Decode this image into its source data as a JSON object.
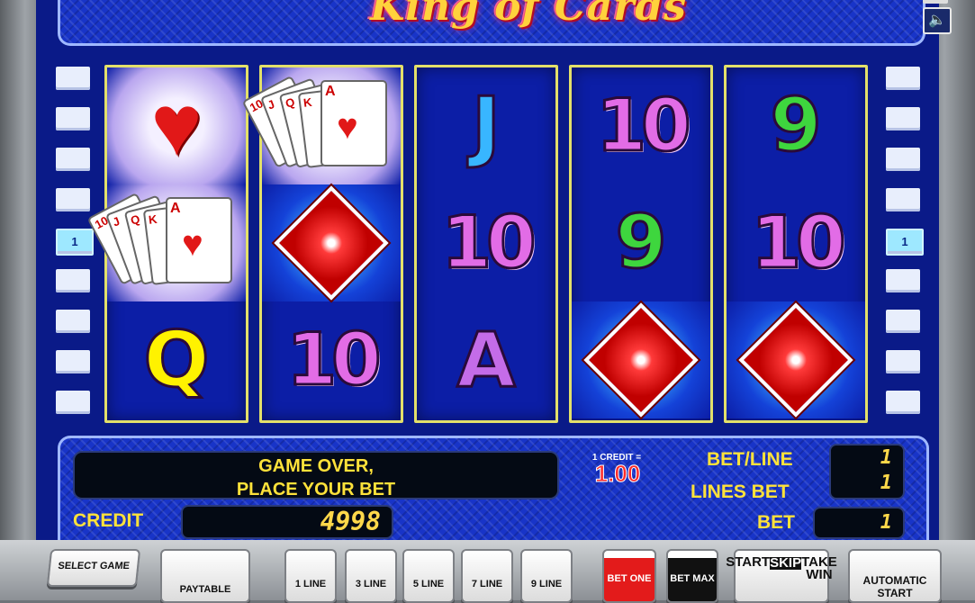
{
  "game": {
    "title": "King of Cards",
    "sound_icon": "speaker-icon"
  },
  "paylines": {
    "left_marker": "1",
    "right_marker": "1"
  },
  "reels": [
    [
      "heart",
      "cards",
      "Q"
    ],
    [
      "cards",
      "diamond",
      "10"
    ],
    [
      "J",
      "10",
      "A"
    ],
    [
      "10",
      "9",
      "diamond"
    ],
    [
      "9",
      "10",
      "diamond"
    ]
  ],
  "status": {
    "message_line1": "GAME OVER,",
    "message_line2": "PLACE YOUR BET",
    "credit_value_label": "1 CREDIT =",
    "credit_value": "1.00"
  },
  "meters": {
    "credit_label": "CREDIT",
    "credit": "4998",
    "bet_line_label": "BET/LINE",
    "bet_line": "1",
    "lines_bet_label": "LINES BET",
    "lines_bet": "1",
    "bet_label": "BET",
    "bet": "1"
  },
  "buttons": {
    "select_game": "SELECT GAME",
    "paytable": "PAYTABLE",
    "line1": "1 LINE",
    "line3": "3 LINE",
    "line5": "5 LINE",
    "line7": "7 LINE",
    "line9": "9 LINE",
    "bet_one": "BET ONE",
    "bet_max": "BET MAX",
    "start": "START",
    "skip": "SKIP",
    "take_win": "TAKE WIN",
    "automatic_start": "AUTOMATIC START"
  },
  "colors": {
    "screen_blue": "#1834c8",
    "reel_frame": "#e3e06a",
    "label_yellow": "#ffe23a"
  }
}
